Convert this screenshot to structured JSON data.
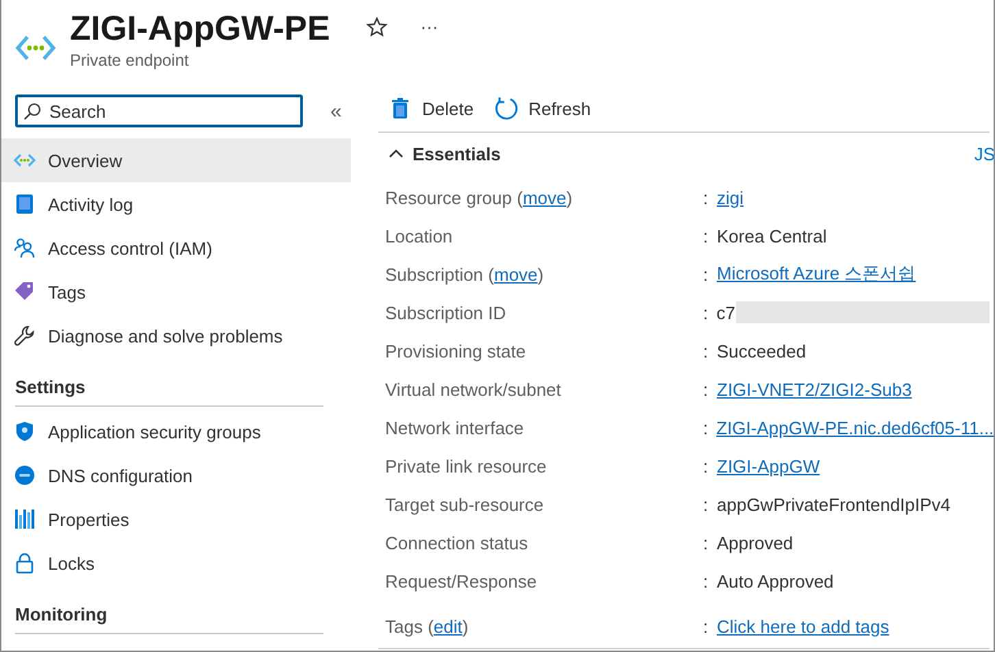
{
  "header": {
    "title": "ZIGI-AppGW-PE",
    "subtitle": "Private endpoint",
    "favorite": false,
    "more": "···"
  },
  "sidebar": {
    "search": {
      "placeholder": "Search"
    },
    "collapse": "«",
    "sections": [
      {
        "items": [
          {
            "label": "Overview",
            "selected": true
          },
          {
            "label": "Activity log",
            "selected": false
          },
          {
            "label": "Access control (IAM)",
            "selected": false
          },
          {
            "label": "Tags",
            "selected": false
          },
          {
            "label": "Diagnose and solve problems",
            "selected": false
          }
        ]
      },
      {
        "heading": "Settings",
        "items": [
          {
            "label": "Application security groups",
            "selected": false
          },
          {
            "label": "DNS configuration",
            "selected": false
          },
          {
            "label": "Properties",
            "selected": false
          },
          {
            "label": "Locks",
            "selected": false
          }
        ]
      },
      {
        "heading": "Monitoring"
      }
    ]
  },
  "toolbar": [
    {
      "label": "Delete"
    },
    {
      "label": "Refresh"
    }
  ],
  "essentials": {
    "heading": "Essentials",
    "expanded": true,
    "json_view": "JS",
    "rows": [
      {
        "label": "Resource group (",
        "action": "move",
        "label_end": ")",
        "separator": ":",
        "value": "zigi",
        "kind": "link"
      },
      {
        "label": "Location",
        "separator": ":",
        "value": "Korea Central",
        "kind": "text"
      },
      {
        "label": "Subscription (",
        "action": "move",
        "label_end": ")",
        "separator": ":",
        "value": "Microsoft Azure 스폰서쉽",
        "kind": "link"
      },
      {
        "label": "Subscription ID",
        "separator": ":",
        "value": "c7",
        "kind": "redacted"
      },
      {
        "label": "Provisioning state",
        "separator": ":",
        "value": "Succeeded",
        "kind": "text"
      },
      {
        "label": "Virtual network/subnet",
        "separator": ":",
        "value": "ZIGI-VNET2/ZIGI2-Sub3",
        "kind": "link"
      },
      {
        "label": "Network interface",
        "separator": ":",
        "value": "ZIGI-AppGW-PE.nic.ded6cf05-11...",
        "kind": "link"
      },
      {
        "label": "Private link resource",
        "separator": ":",
        "value": "ZIGI-AppGW",
        "kind": "link"
      },
      {
        "label": "Target sub-resource",
        "separator": ":",
        "value": "appGwPrivateFrontendIpIPv4",
        "kind": "text"
      },
      {
        "label": "Connection status",
        "separator": ":",
        "value": "Approved",
        "kind": "text"
      },
      {
        "label": "Request/Response",
        "separator": ":",
        "value": "Auto Approved",
        "kind": "text"
      }
    ],
    "tags": {
      "label": "Tags (",
      "action": "edit",
      "label_end": ")",
      "separator": ":",
      "value": "Click here to add tags"
    }
  }
}
